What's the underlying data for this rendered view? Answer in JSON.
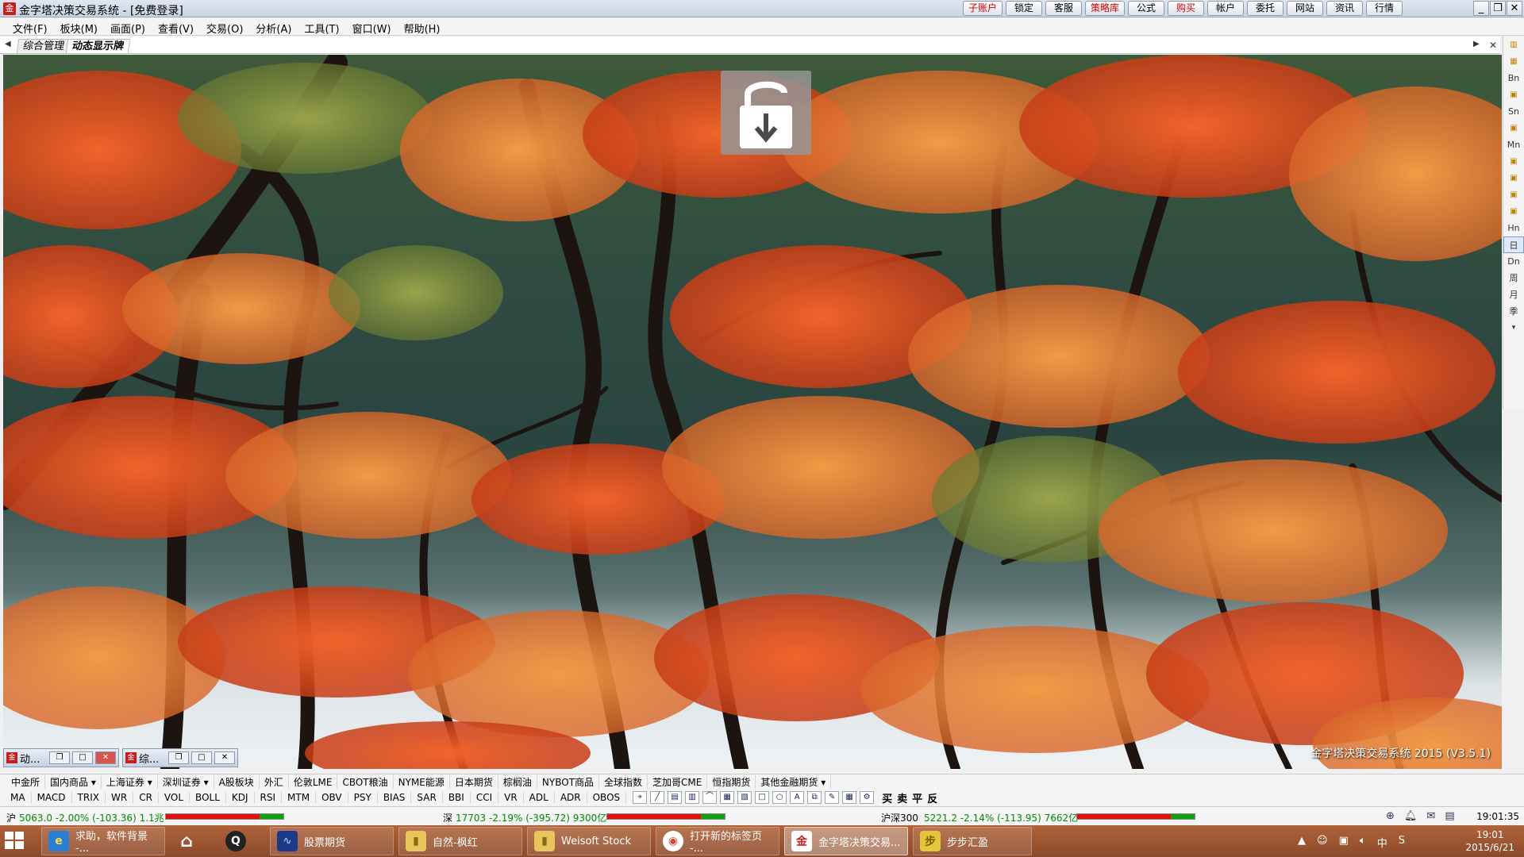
{
  "window": {
    "title": "金字塔决策交易系统 - [免费登录]",
    "app_icon": "pyramid-app-icon"
  },
  "quick_buttons": [
    {
      "label": "子账户",
      "highlight": true
    },
    {
      "label": "锁定",
      "highlight": false
    },
    {
      "label": "客服",
      "highlight": false
    },
    {
      "label": "策略库",
      "highlight": true
    },
    {
      "label": "公式",
      "highlight": false
    },
    {
      "label": "购买",
      "highlight": true
    },
    {
      "label": "帐户",
      "highlight": false
    },
    {
      "label": "委托",
      "highlight": false
    },
    {
      "label": "网站",
      "highlight": false
    },
    {
      "label": "资讯",
      "highlight": false
    },
    {
      "label": "行情",
      "highlight": false
    }
  ],
  "menu": [
    "文件(F)",
    "板块(M)",
    "画面(P)",
    "查看(V)",
    "交易(O)",
    "分析(A)",
    "工具(T)",
    "窗口(W)",
    "帮助(H)"
  ],
  "tabs": [
    {
      "label": "综合管理",
      "active": false
    },
    {
      "label": "动态显示牌",
      "active": true
    }
  ],
  "watermark": "金字塔决策交易系统 2015 (V3.5.1)",
  "right_toolbar": [
    {
      "label": "Bn",
      "kind": "text"
    },
    {
      "label": "Sn",
      "kind": "text"
    },
    {
      "label": "Mn",
      "kind": "text"
    },
    {
      "label": "Hn",
      "kind": "text"
    },
    {
      "label": "日",
      "kind": "text",
      "selected": true
    },
    {
      "label": "Dn",
      "kind": "text"
    },
    {
      "label": "周",
      "kind": "text"
    },
    {
      "label": "月",
      "kind": "text"
    },
    {
      "label": "季",
      "kind": "text"
    }
  ],
  "mini_windows": [
    {
      "title": "动..."
    },
    {
      "title": "综..."
    }
  ],
  "market_tabs": [
    "中金所",
    "国内商品",
    "上海证券",
    "深圳证券",
    "A股板块",
    "外汇",
    "伦敦LME",
    "CBOT粮油",
    "NYME能源",
    "日本期货",
    "棕榈油",
    "NYBOT商品",
    "全球指数",
    "芝加哥CME",
    "恒指期货",
    "其他金融期货"
  ],
  "indicators": [
    "MA",
    "MACD",
    "TRIX",
    "WR",
    "CR",
    "VOL",
    "BOLL",
    "KDJ",
    "RSI",
    "MTM",
    "OBV",
    "PSY",
    "BIAS",
    "SAR",
    "BBI",
    "CCI",
    "VR",
    "ADL",
    "ADR",
    "OBOS"
  ],
  "trade_buttons": [
    "买",
    "卖",
    "平",
    "反"
  ],
  "status": {
    "sh_label": "沪",
    "sh": "5063.0 -2.00% (-103.36) 1.1兆",
    "sz_label": "深",
    "sz": "17703 -2.19% (-395.72) 9300亿",
    "hs_label": "沪深300",
    "hs": "5221.2 -2.14% (-113.95) 7662亿",
    "time": "19:01:35"
  },
  "taskbar": {
    "items": [
      {
        "label": "求助，软件背景 -...",
        "icon": "ie-browser-icon"
      },
      {
        "label": "",
        "icon": "home-icon"
      },
      {
        "label": "",
        "icon": "qq-penguin-icon"
      },
      {
        "label": "股票期货",
        "icon": "stock-chart-icon"
      },
      {
        "label": "自然-枫红",
        "icon": "folder-icon"
      },
      {
        "label": "Weisoft Stock",
        "icon": "folder-icon"
      },
      {
        "label": "打开新的标签页 -...",
        "icon": "chrome-icon"
      },
      {
        "label": "金字塔决策交易...",
        "icon": "pyramid-app-icon"
      },
      {
        "label": "步步汇盈",
        "icon": "bubu-app-icon"
      }
    ],
    "tray_ime": "中",
    "time": "19:01",
    "date": "2015/6/21"
  }
}
